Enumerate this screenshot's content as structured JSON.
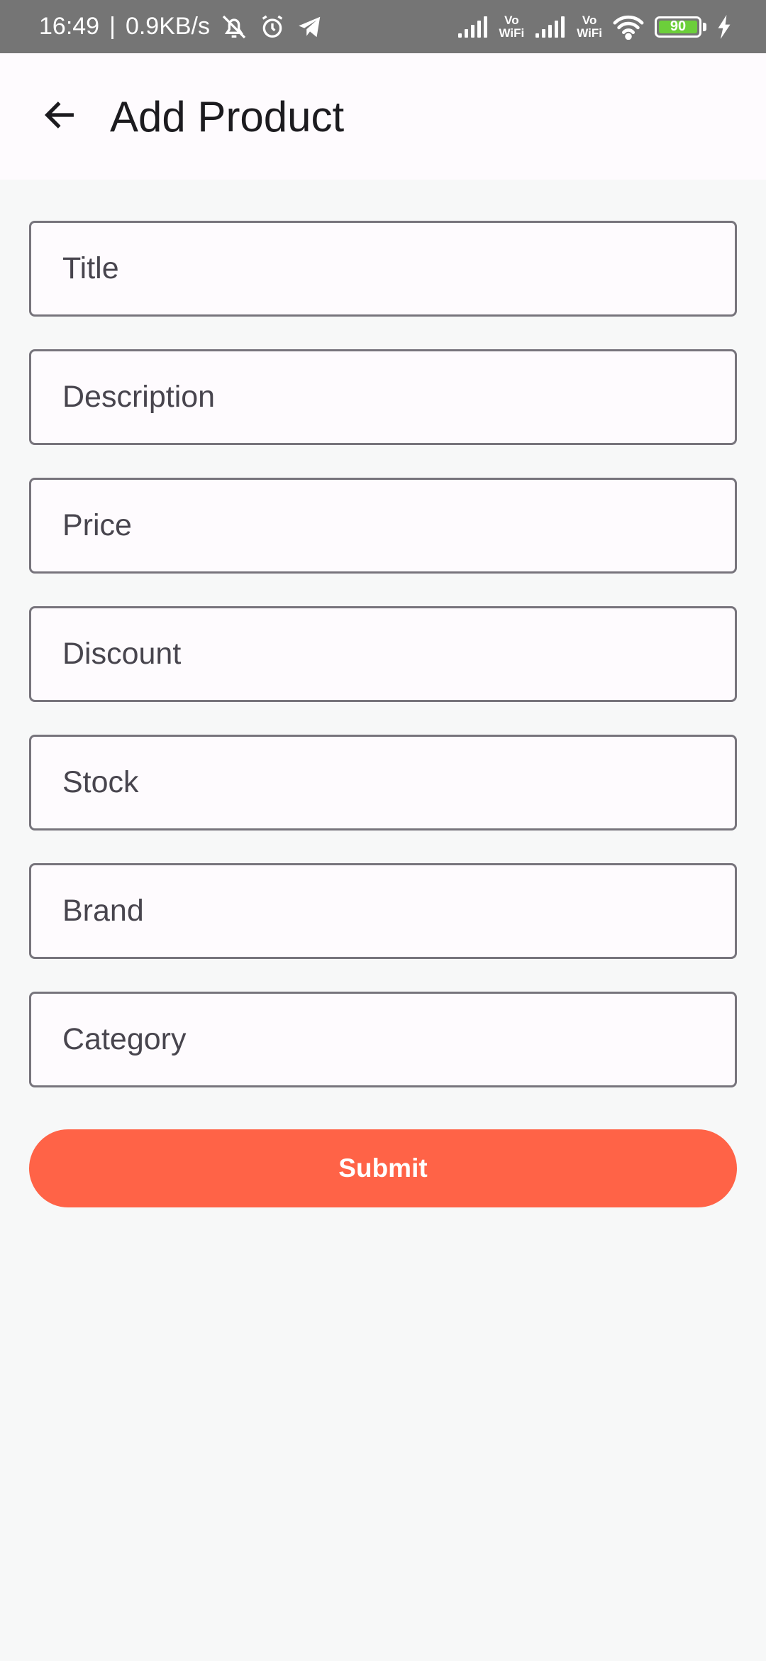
{
  "status_bar": {
    "time": "16:49",
    "separator": "|",
    "network_speed": "0.9KB/s",
    "vowifi_1": [
      "Vo",
      "WiFi"
    ],
    "vowifi_2": [
      "Vo",
      "WiFi"
    ],
    "battery_level": "90",
    "battery_color": "#6ccf3a",
    "icons": [
      "mute-bell-icon",
      "alarm-icon",
      "telegram-icon",
      "signal-icon",
      "wifi-icon",
      "battery-icon",
      "charging-icon"
    ]
  },
  "app_bar": {
    "title": "Add Product",
    "back_icon": "arrow-back-icon"
  },
  "form": {
    "fields": [
      {
        "key": "title",
        "placeholder": "Title"
      },
      {
        "key": "description",
        "placeholder": "Description"
      },
      {
        "key": "price",
        "placeholder": "Price"
      },
      {
        "key": "discount",
        "placeholder": "Discount"
      },
      {
        "key": "stock",
        "placeholder": "Stock"
      },
      {
        "key": "brand",
        "placeholder": "Brand"
      },
      {
        "key": "category",
        "placeholder": "Category"
      }
    ],
    "submit_label": "Submit"
  },
  "colors": {
    "accent": "#ff6347",
    "status_bar_bg": "#757575",
    "app_bar_bg": "#fefbfe",
    "page_bg": "#f7f8f8",
    "field_border": "#77747c"
  }
}
